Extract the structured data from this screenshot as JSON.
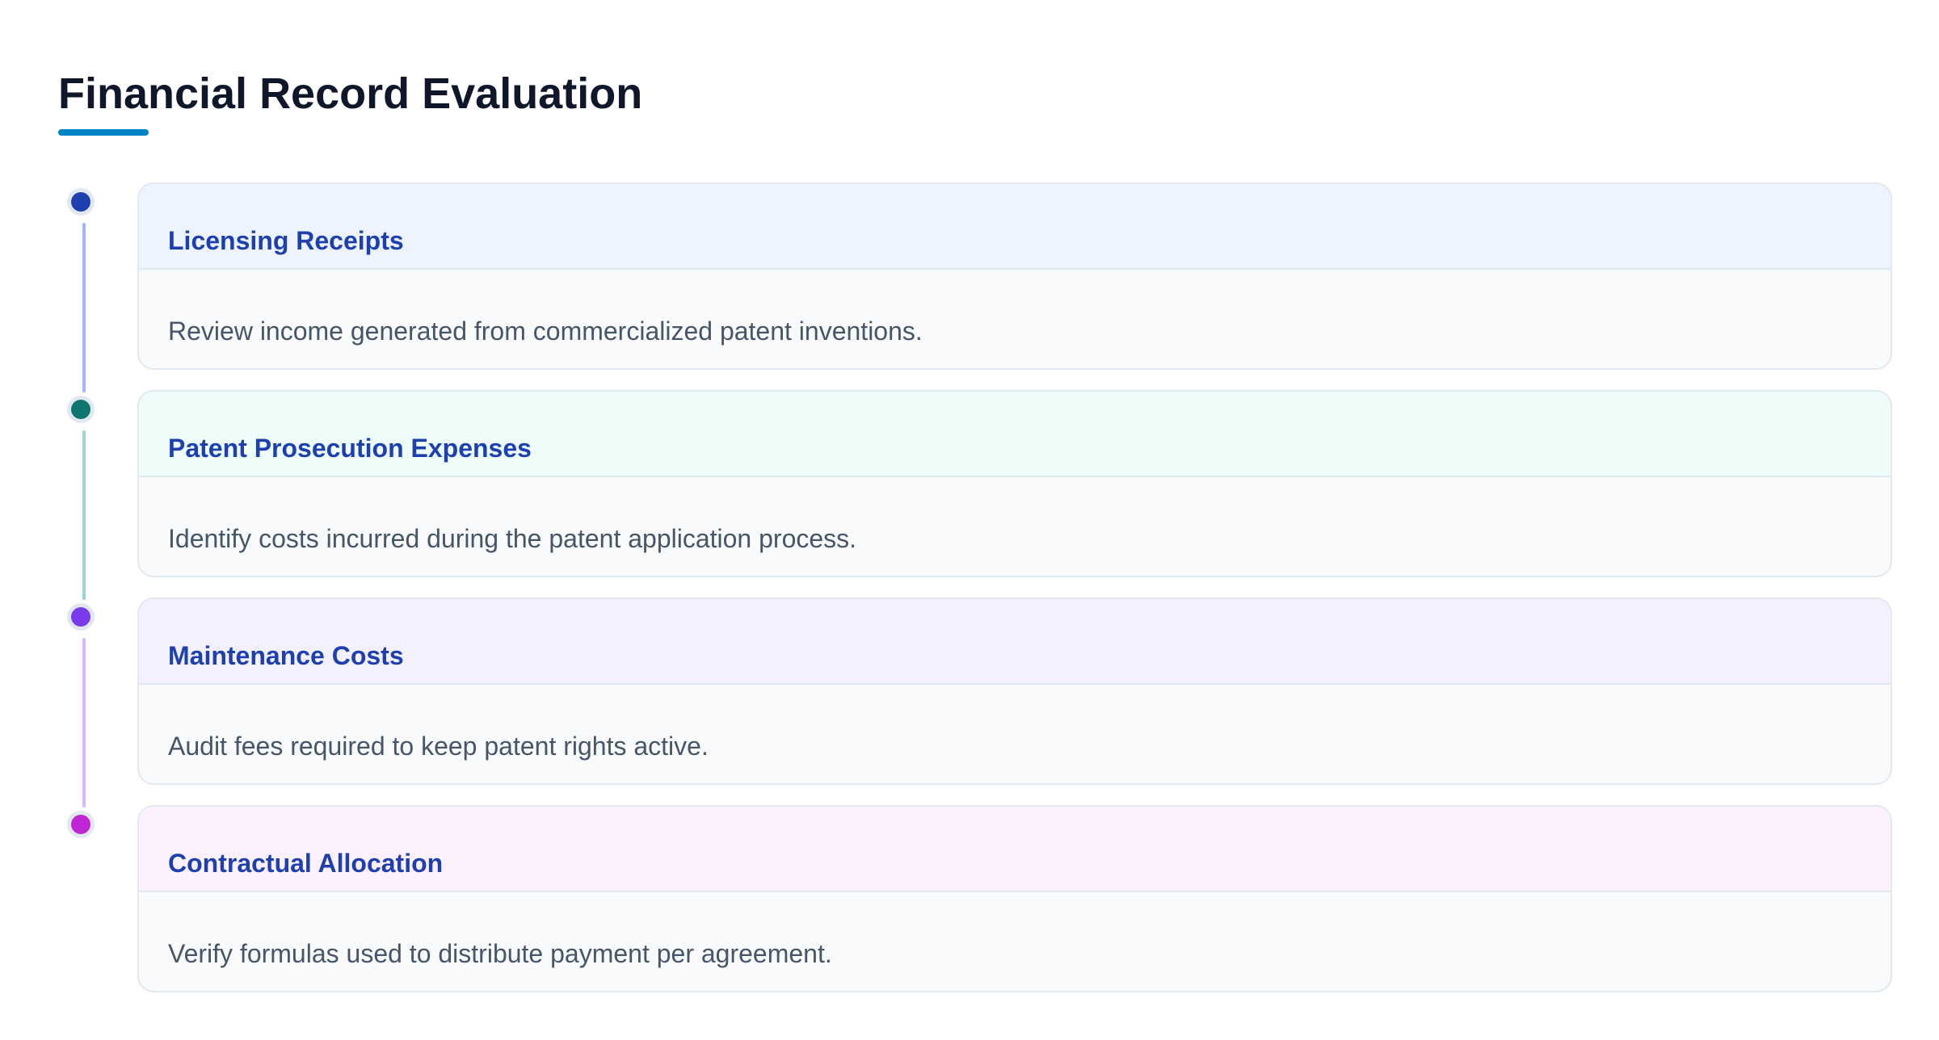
{
  "title": "Financial Record Evaluation",
  "colors": {
    "accent": "#0284c7",
    "heading": "#1e40af"
  },
  "steps": [
    {
      "title": "Licensing Receipts",
      "description": "Review income generated from commercialized patent inventions.",
      "dot_color": "#1e40af",
      "line_color": "#a5b4fc",
      "header_color": "#eef4ff"
    },
    {
      "title": "Patent Prosecution Expenses",
      "description": "Identify costs incurred during the patent application process.",
      "dot_color": "#0f766e",
      "line_color": "#99d5cc",
      "header_color": "#eefcfa"
    },
    {
      "title": "Maintenance Costs",
      "description": "Audit fees required to keep patent rights active.",
      "dot_color": "#7c3aed",
      "line_color": "#d8b4fe",
      "header_color": "#f4f1ff"
    },
    {
      "title": "Contractual Allocation",
      "description": "Verify formulas used to distribute payment per agreement.",
      "dot_color": "#c026d3",
      "line_color": "",
      "header_color": "#fdf1ff"
    }
  ]
}
